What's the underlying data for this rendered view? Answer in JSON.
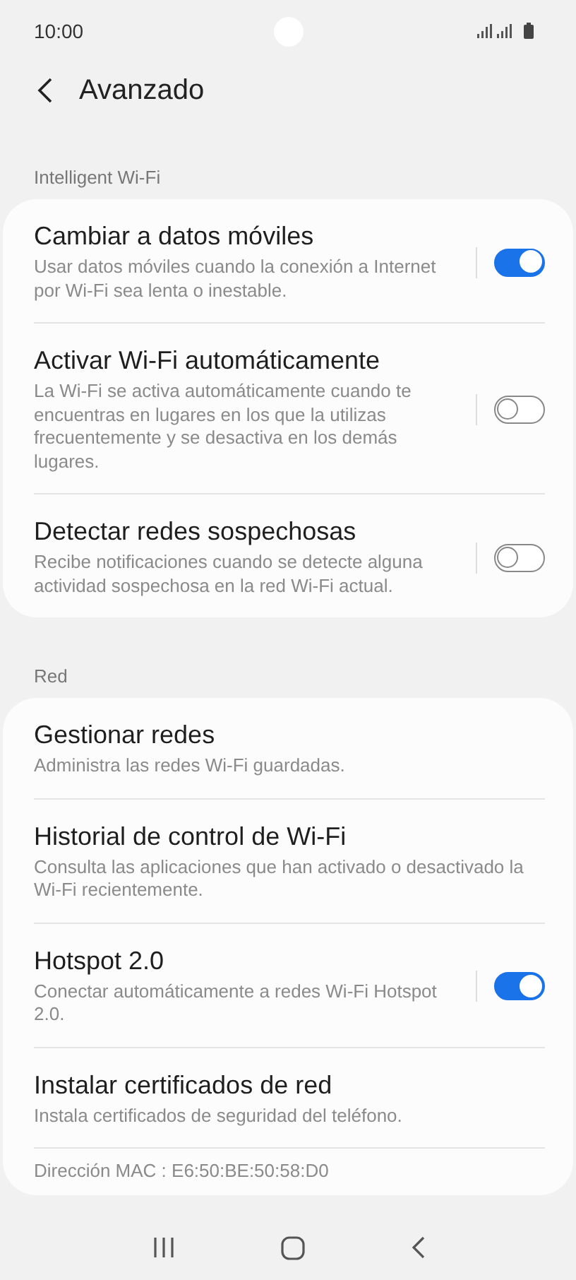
{
  "status_bar": {
    "time": "10:00"
  },
  "header": {
    "title": "Avanzado"
  },
  "sections": [
    {
      "title": "Intelligent Wi-Fi",
      "items": [
        {
          "kind": "switch",
          "title": "Cambiar a datos móviles",
          "subtitle": "Usar datos móviles cuando la conexión a Internet por Wi-Fi sea lenta o inestable.",
          "on": true
        },
        {
          "kind": "switch",
          "title": "Activar Wi-Fi automáticamente",
          "subtitle": "La Wi-Fi se activa automáticamente cuando te encuentras en lugares en los que la utilizas frecuentemente y se desactiva en los demás lugares.",
          "on": false
        },
        {
          "kind": "switch",
          "title": "Detectar redes sospechosas",
          "subtitle": "Recibe notificaciones cuando se detecte alguna actividad sospechosa en la red Wi-Fi actual.",
          "on": false
        }
      ]
    },
    {
      "title": "Red",
      "items": [
        {
          "kind": "link",
          "title": "Gestionar redes",
          "subtitle": "Administra las redes Wi-Fi guardadas."
        },
        {
          "kind": "link",
          "title": "Historial de control de Wi-Fi",
          "subtitle": "Consulta las aplicaciones que han activado o desactivado la Wi-Fi recientemente."
        },
        {
          "kind": "switch",
          "title": "Hotspot 2.0",
          "subtitle": "Conectar automáticamente a redes Wi-Fi Hotspot 2.0.",
          "on": true
        },
        {
          "kind": "link",
          "title": "Instalar certificados de red",
          "subtitle": "Instala certificados de seguridad del teléfono."
        },
        {
          "kind": "info",
          "subtitle": "Dirección MAC : E6:50:BE:50:58:D0"
        }
      ]
    }
  ]
}
